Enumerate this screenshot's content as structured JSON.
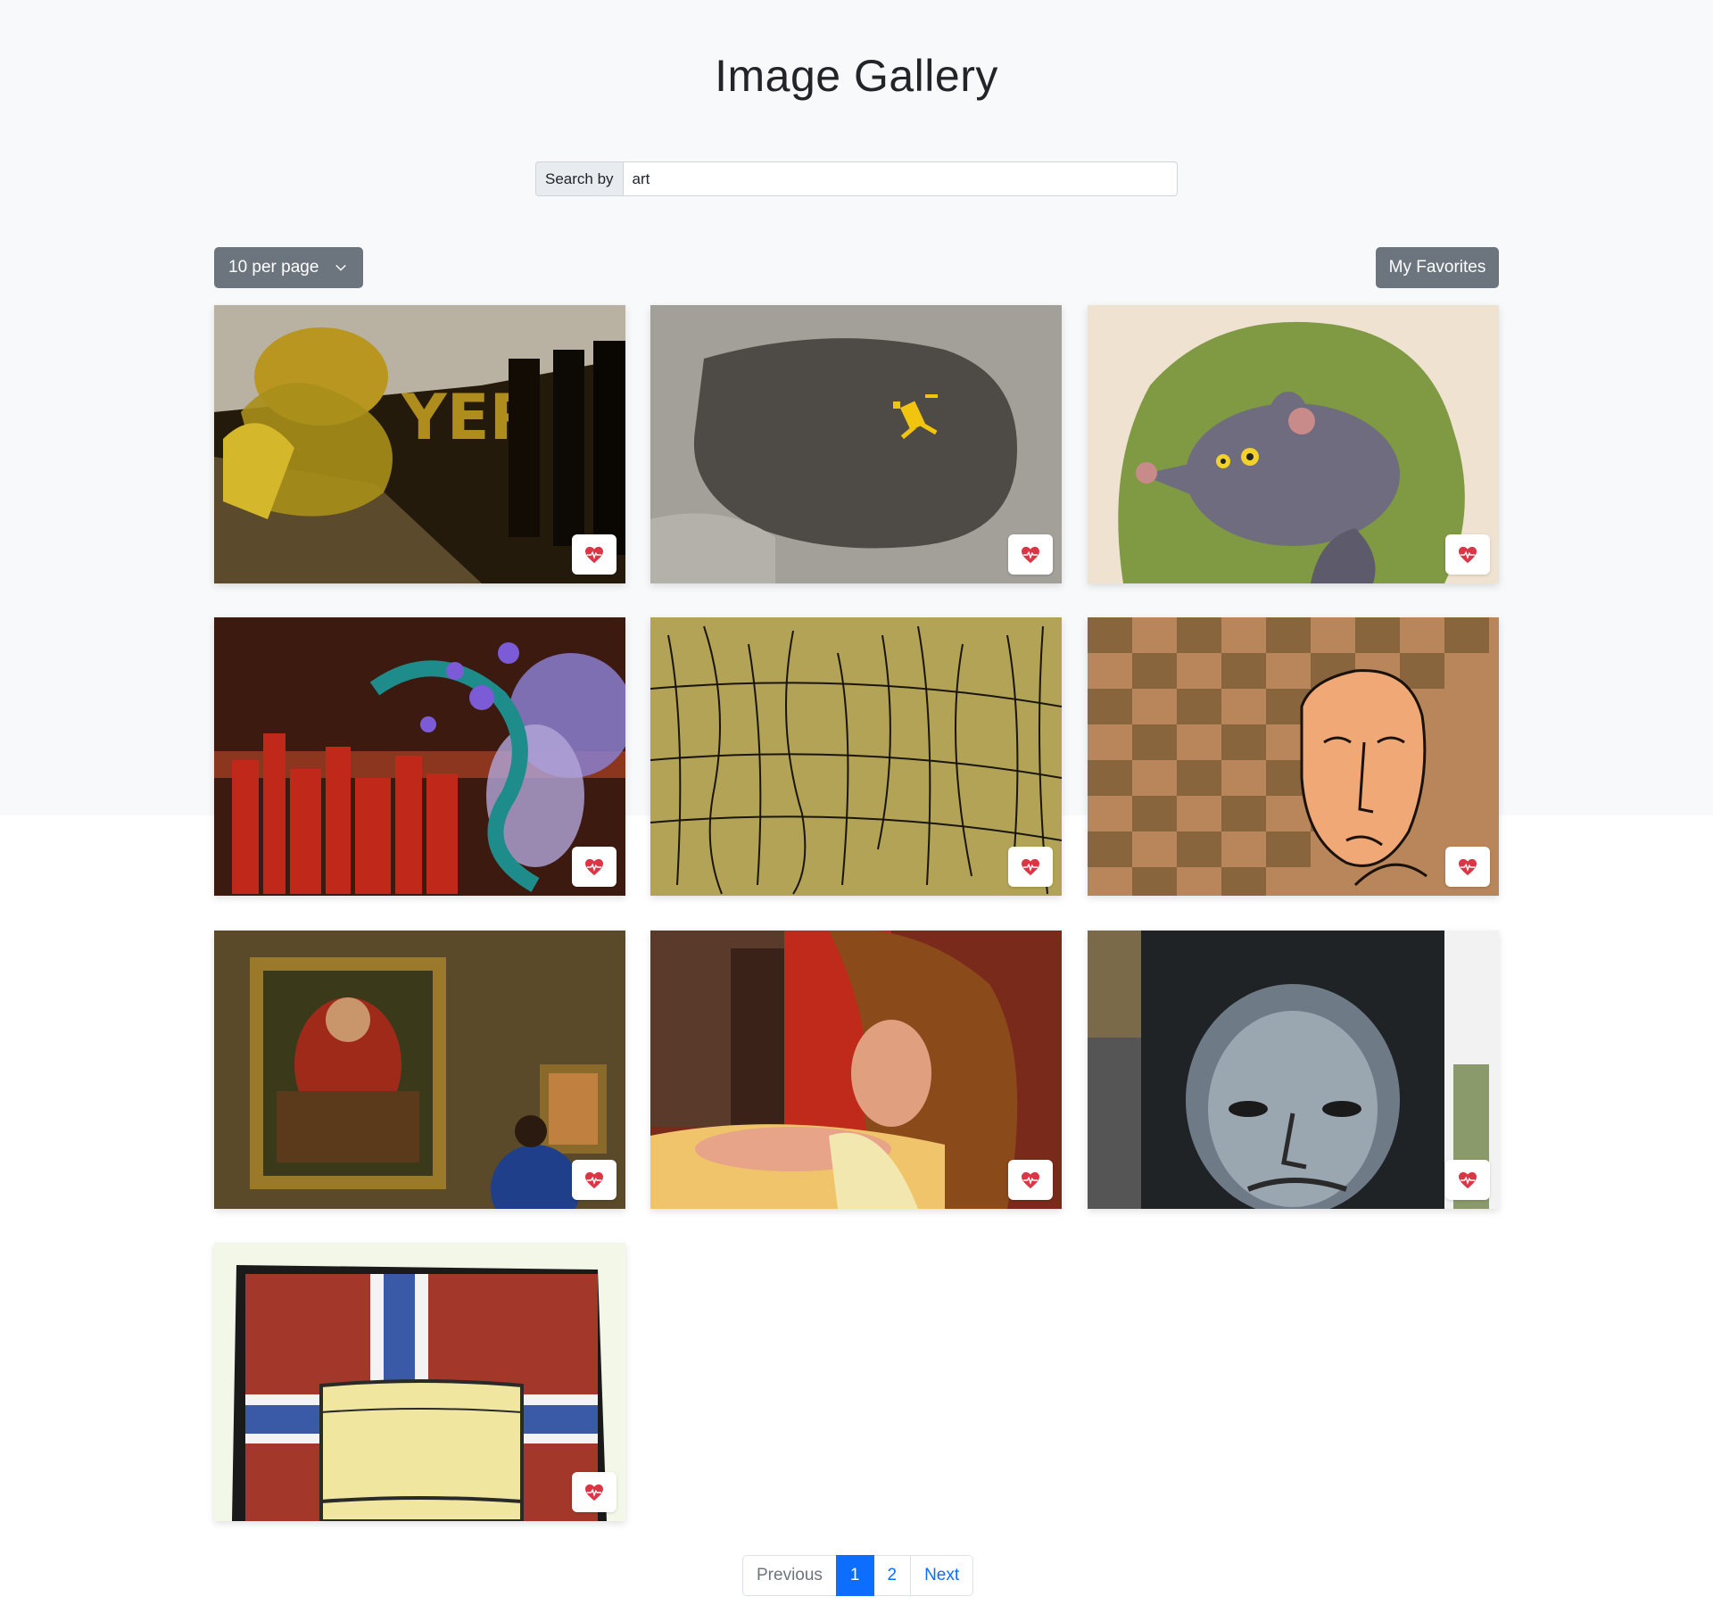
{
  "header": {
    "title": "Image Gallery"
  },
  "search": {
    "label": "Search by",
    "value": "art"
  },
  "toolbar": {
    "per_page_label": "10 per page",
    "favorites_label": "My Favorites"
  },
  "gallery": {
    "images": [
      {
        "subject": "graffiti-tunnel"
      },
      {
        "subject": "yellow-figure-on-asphalt"
      },
      {
        "subject": "cartoon-rat"
      },
      {
        "subject": "abstract-city-swirls"
      },
      {
        "subject": "line-drawing-figures"
      },
      {
        "subject": "face-on-weave-pattern"
      },
      {
        "subject": "museum-painting-visitor"
      },
      {
        "subject": "painted-woman"
      },
      {
        "subject": "mural-face"
      },
      {
        "subject": "norway-flag-paint-can"
      }
    ],
    "favorite_icon": "heart-pulse-icon",
    "favorite_color": "#dc3545"
  },
  "pagination": {
    "previous": "Previous",
    "pages": [
      "1",
      "2"
    ],
    "current": "1",
    "next": "Next"
  },
  "colors": {
    "accent": "#0d6efd",
    "secondary": "#6c757d",
    "background_top": "#f8f9fa"
  }
}
